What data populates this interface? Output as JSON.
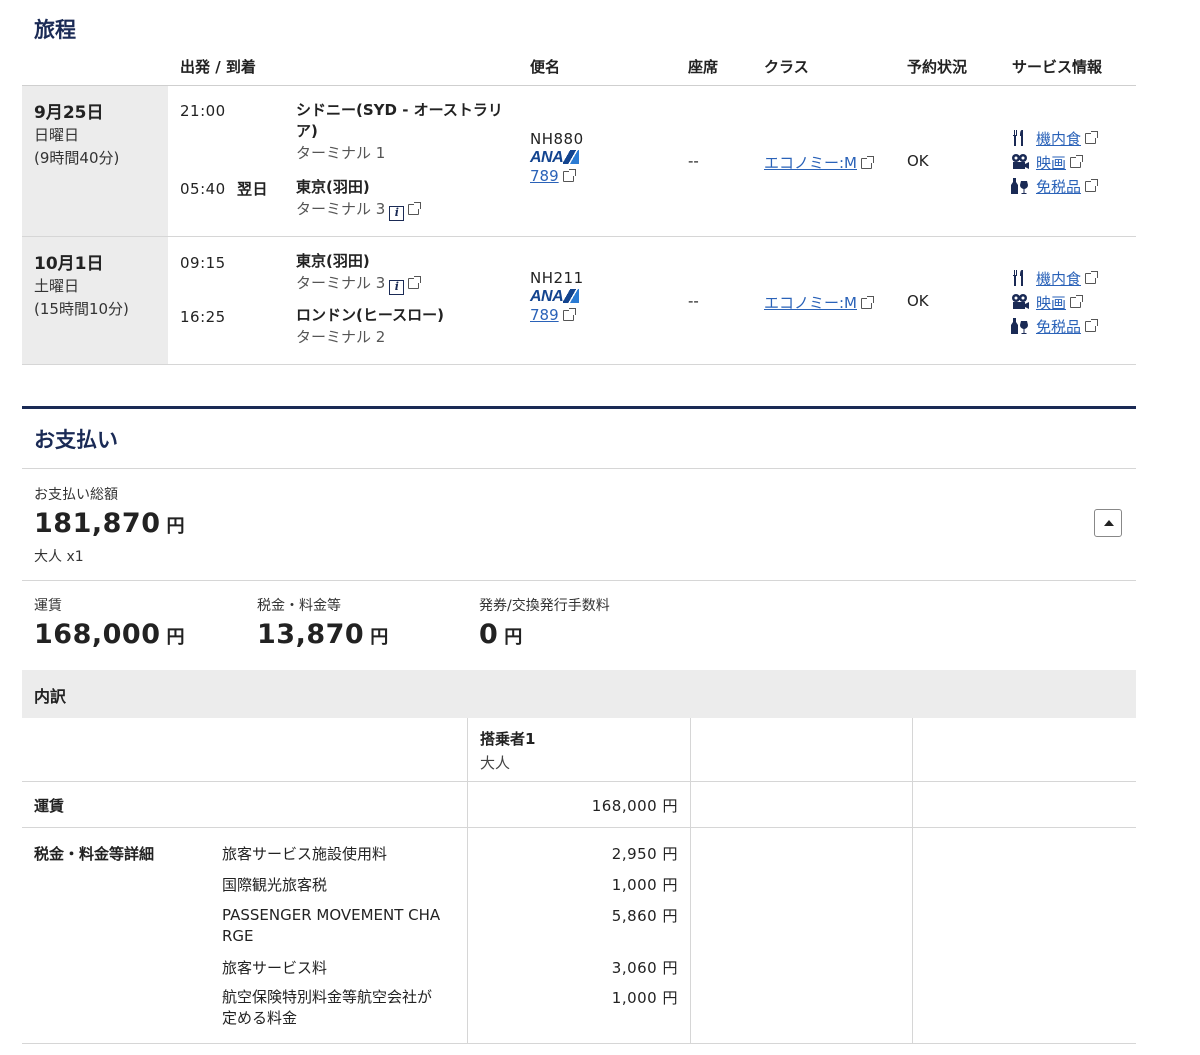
{
  "itinerary": {
    "title": "旅程",
    "headers": {
      "dep_arr": "出発 / 到着",
      "flight": "便名",
      "seat": "座席",
      "class": "クラス",
      "status": "予約状況",
      "service": "サービス情報"
    },
    "segments": [
      {
        "date": "9月25日",
        "weekday": "日曜日",
        "duration": "(9時間40分)",
        "dep_time": "21:00",
        "dep_city": "シドニー(SYD - オーストラリア)",
        "dep_city_line1": "シドニー(SYD - オーストラリ",
        "dep_city_line2": "ア)",
        "dep_terminal": "ターミナル 1",
        "arr_time": "05:40",
        "arr_next_day": "翌日",
        "arr_city": "東京(羽田)",
        "arr_terminal": "ターミナル 3",
        "flight_no": "NH880",
        "airline_logo": "ANA",
        "aircraft": "789",
        "seat": "--",
        "class_link": "エコノミー:M",
        "status": "OK",
        "services": [
          "機内食",
          "映画",
          "免税品"
        ]
      },
      {
        "date": "10月1日",
        "weekday": "土曜日",
        "duration": "(15時間10分)",
        "dep_time": "09:15",
        "dep_city": "東京(羽田)",
        "dep_terminal": "ターミナル 3",
        "arr_time": "16:25",
        "arr_city": "ロンドン(ヒースロー)",
        "arr_terminal": "ターミナル 2",
        "flight_no": "NH211",
        "airline_logo": "ANA",
        "aircraft": "789",
        "seat": "--",
        "class_link": "エコノミー:M",
        "status": "OK",
        "services": [
          "機内食",
          "映画",
          "免税品"
        ]
      }
    ]
  },
  "payment": {
    "title": "お支払い",
    "total_label": "お支払い総額",
    "total_amount": "181,870",
    "yen": "円",
    "passengers": "大人 x1",
    "fare_label": "運賃",
    "fare_amount": "168,000",
    "tax_label": "税金・料金等",
    "tax_amount": "13,870",
    "fee_label": "発券/交換発行手数料",
    "fee_amount": "0"
  },
  "breakdown": {
    "title": "内訳",
    "passenger_label": "搭乗者1",
    "passenger_type": "大人",
    "fare_row_label": "運賃",
    "fare_row_amount": "168,000 円",
    "tax_row_label": "税金・料金等詳細",
    "tax_items": [
      {
        "name": "旅客サービス施設使用料",
        "amount": "2,950 円"
      },
      {
        "name": "国際観光旅客税",
        "amount": "1,000 円"
      },
      {
        "name_line1": "PASSENGER MOVEMENT CHA",
        "name_line2": "RGE",
        "amount": "5,860 円"
      },
      {
        "name": "旅客サービス料",
        "amount": "3,060 円"
      },
      {
        "name_line1": "航空保険特別料金等航空会社が",
        "name_line2": "定める料金",
        "amount": "1,000 円"
      }
    ]
  },
  "icons": {
    "external_link": "external-link-icon",
    "info": "info-icon",
    "meal": "fork-knife-icon",
    "movie": "movie-camera-icon",
    "duty_free": "duty-free-bottle-icon",
    "collapse": "caret-up-icon"
  },
  "colors": {
    "navy": "#1a2a55",
    "link": "#2a62b8",
    "ana_blue": "#13448f",
    "date_bg": "#ececec"
  }
}
